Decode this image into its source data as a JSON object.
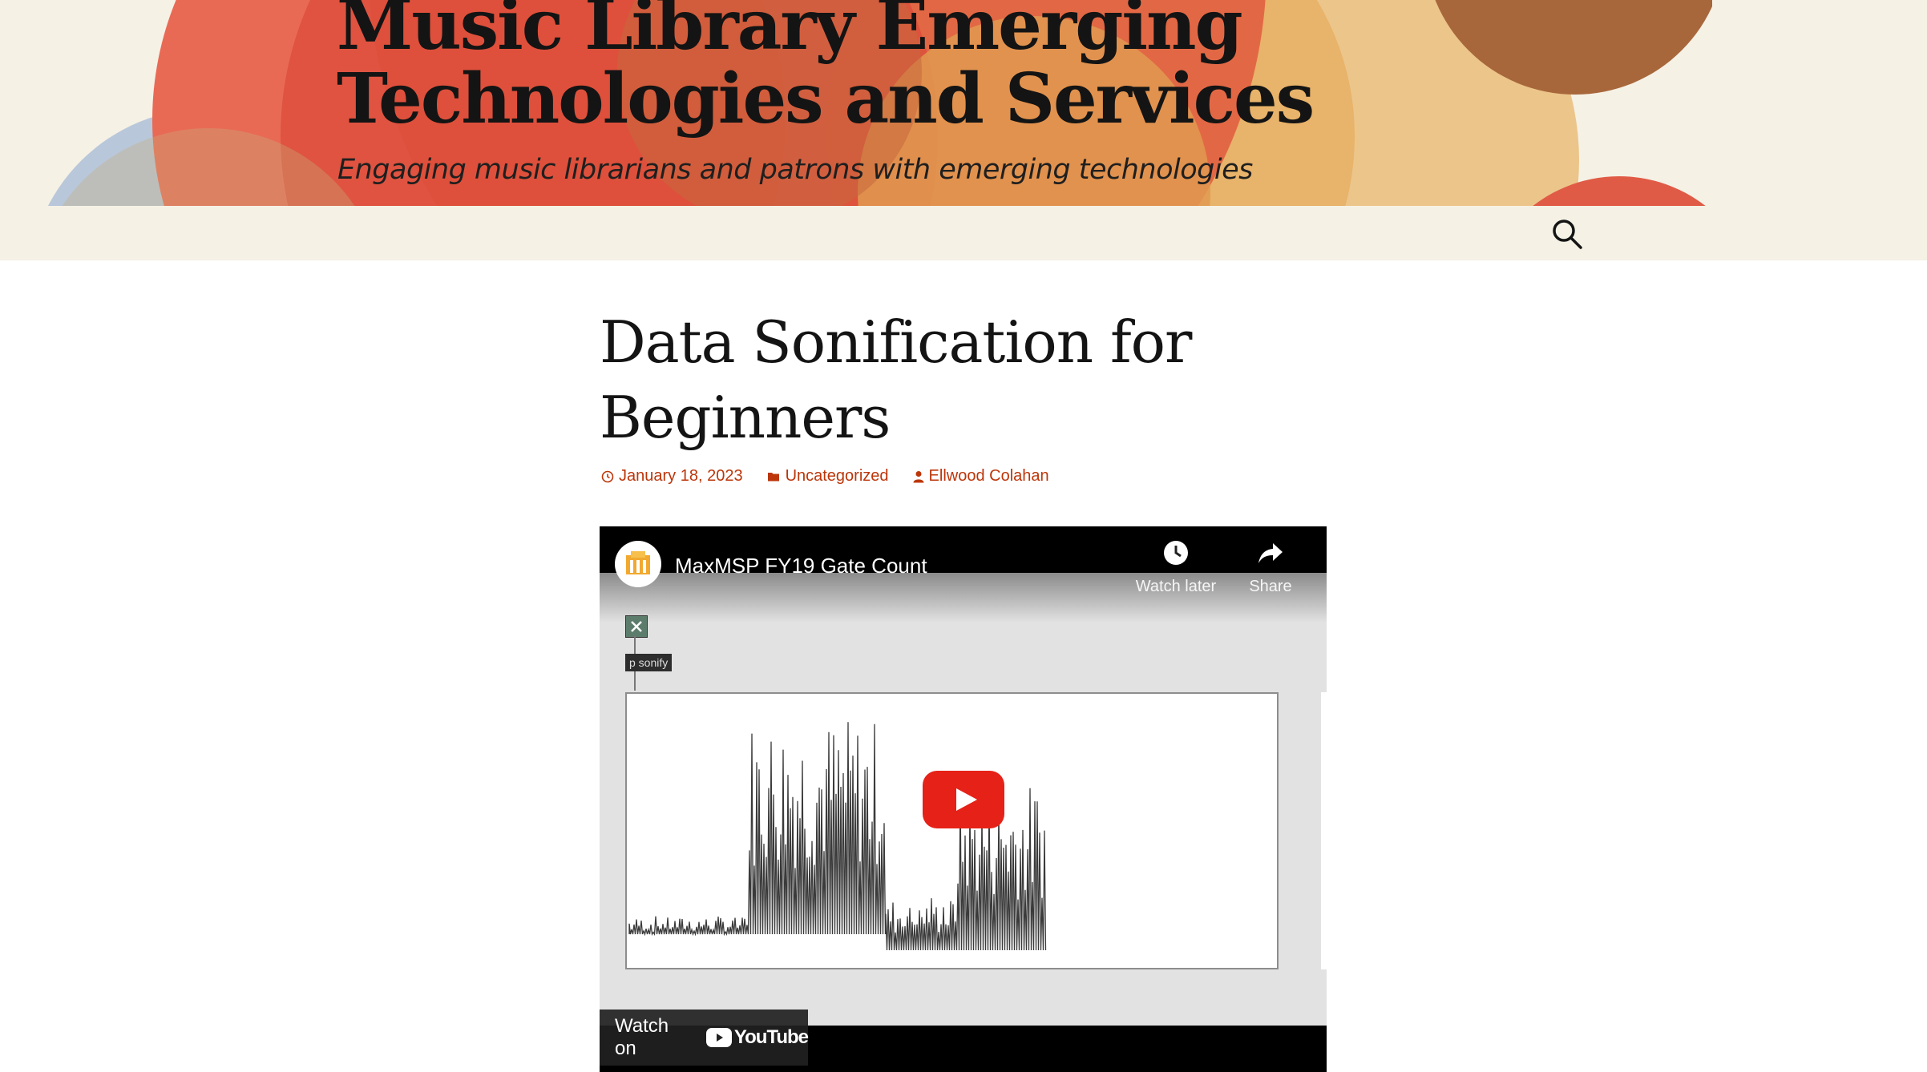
{
  "site": {
    "title": "Music Library Emerging Technologies and Services",
    "description": "Engaging music librarians and patrons with emerging technologies"
  },
  "nav": {
    "search_icon": "search-icon"
  },
  "post": {
    "title": "Data Sonification for Beginners",
    "meta": {
      "date": "January 18, 2023",
      "category": "Uncategorized",
      "author": "Ellwood Colahan"
    }
  },
  "video": {
    "title": "MaxMSP FY19 Gate Count",
    "watch_later": "Watch later",
    "share": "Share",
    "patch_object": "p sonify",
    "watch_on": "Watch on",
    "youtube": "YouTube",
    "play_icon": "play-icon"
  },
  "colors": {
    "link": "#bc360a",
    "header_bg": "#f5f1e5",
    "play_red": "#e62117"
  }
}
